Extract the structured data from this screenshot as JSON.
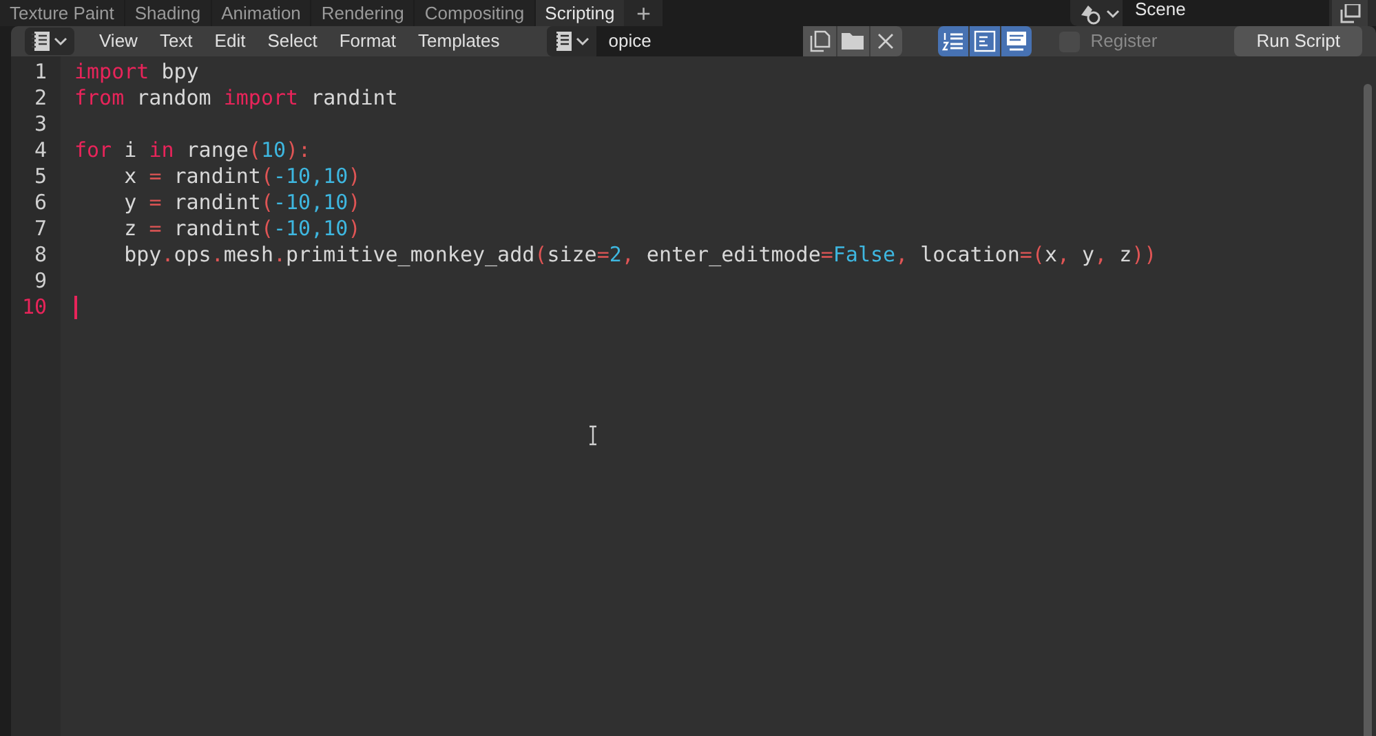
{
  "workspace_tabs": [
    {
      "label": "Texture Paint",
      "selected": false
    },
    {
      "label": "Shading",
      "selected": false
    },
    {
      "label": "Animation",
      "selected": false
    },
    {
      "label": "Rendering",
      "selected": false
    },
    {
      "label": "Compositing",
      "selected": false
    },
    {
      "label": "Scripting",
      "selected": true
    }
  ],
  "add_tab": "+",
  "scene": {
    "name": "Scene"
  },
  "header": {
    "menus": [
      "View",
      "Text",
      "Edit",
      "Select",
      "Format",
      "Templates"
    ],
    "text_name": "opice",
    "toggles": [
      {
        "kind": "line_numbers",
        "on": true
      },
      {
        "kind": "word_wrap",
        "on": true
      },
      {
        "kind": "syntax",
        "on": true
      }
    ],
    "register": {
      "label": "Register",
      "checked": false
    },
    "run_button": "Run Script"
  },
  "lines": [
    {
      "number": "1",
      "current": false,
      "tokens": [
        {
          "kind": "kw",
          "text": "import"
        },
        {
          "kind": "plain",
          "text": " bpy"
        }
      ]
    },
    {
      "number": "2",
      "current": false,
      "tokens": [
        {
          "kind": "kw",
          "text": "from"
        },
        {
          "kind": "plain",
          "text": " random "
        },
        {
          "kind": "kw",
          "text": "import"
        },
        {
          "kind": "plain",
          "text": " randint"
        }
      ]
    },
    {
      "number": "3",
      "current": false
    },
    {
      "number": "4",
      "current": false,
      "tokens": [
        {
          "kind": "kw",
          "text": "for"
        },
        {
          "kind": "plain",
          "text": " i "
        },
        {
          "kind": "kw",
          "text": "in"
        },
        {
          "kind": "plain",
          "text": " range"
        },
        {
          "kind": "op",
          "text": "("
        },
        {
          "kind": "num",
          "text": "10"
        },
        {
          "kind": "op",
          "text": "):"
        }
      ]
    },
    {
      "number": "5",
      "current": false,
      "tokens": [
        {
          "kind": "plain",
          "text": "    x "
        },
        {
          "kind": "op",
          "text": "="
        },
        {
          "kind": "plain",
          "text": " randint"
        },
        {
          "kind": "op",
          "text": "("
        },
        {
          "kind": "num",
          "text": "-10,10"
        },
        {
          "kind": "op",
          "text": ")"
        }
      ]
    },
    {
      "number": "6",
      "current": false,
      "tokens": [
        {
          "kind": "plain",
          "text": "    y "
        },
        {
          "kind": "op",
          "text": "="
        },
        {
          "kind": "plain",
          "text": " randint"
        },
        {
          "kind": "op",
          "text": "("
        },
        {
          "kind": "num",
          "text": "-10,10"
        },
        {
          "kind": "op",
          "text": ")"
        }
      ]
    },
    {
      "number": "7",
      "current": false,
      "tokens": [
        {
          "kind": "plain",
          "text": "    z "
        },
        {
          "kind": "op",
          "text": "="
        },
        {
          "kind": "plain",
          "text": " randint"
        },
        {
          "kind": "op",
          "text": "("
        },
        {
          "kind": "num",
          "text": "-10,10"
        },
        {
          "kind": "op",
          "text": ")"
        }
      ]
    },
    {
      "number": "8",
      "current": false,
      "tokens": [
        {
          "kind": "plain",
          "text": "    bpy"
        },
        {
          "kind": "op",
          "text": "."
        },
        {
          "kind": "plain",
          "text": "ops"
        },
        {
          "kind": "op",
          "text": "."
        },
        {
          "kind": "plain",
          "text": "mesh"
        },
        {
          "kind": "op",
          "text": "."
        },
        {
          "kind": "plain",
          "text": "primitive_monkey_add"
        },
        {
          "kind": "op",
          "text": "("
        },
        {
          "kind": "plain",
          "text": "size"
        },
        {
          "kind": "op",
          "text": "="
        },
        {
          "kind": "num",
          "text": "2"
        },
        {
          "kind": "op",
          "text": ","
        },
        {
          "kind": "plain",
          "text": " enter_editmode"
        },
        {
          "kind": "op",
          "text": "="
        },
        {
          "kind": "num",
          "text": "False"
        },
        {
          "kind": "op",
          "text": ","
        },
        {
          "kind": "plain",
          "text": " location"
        },
        {
          "kind": "op",
          "text": "=("
        },
        {
          "kind": "plain",
          "text": "x"
        },
        {
          "kind": "op",
          "text": ","
        },
        {
          "kind": "plain",
          "text": " y"
        },
        {
          "kind": "op",
          "text": ","
        },
        {
          "kind": "plain",
          "text": " z"
        },
        {
          "kind": "op",
          "text": "))"
        }
      ]
    },
    {
      "number": "9",
      "current": false
    },
    {
      "number": "10",
      "current": true
    }
  ]
}
